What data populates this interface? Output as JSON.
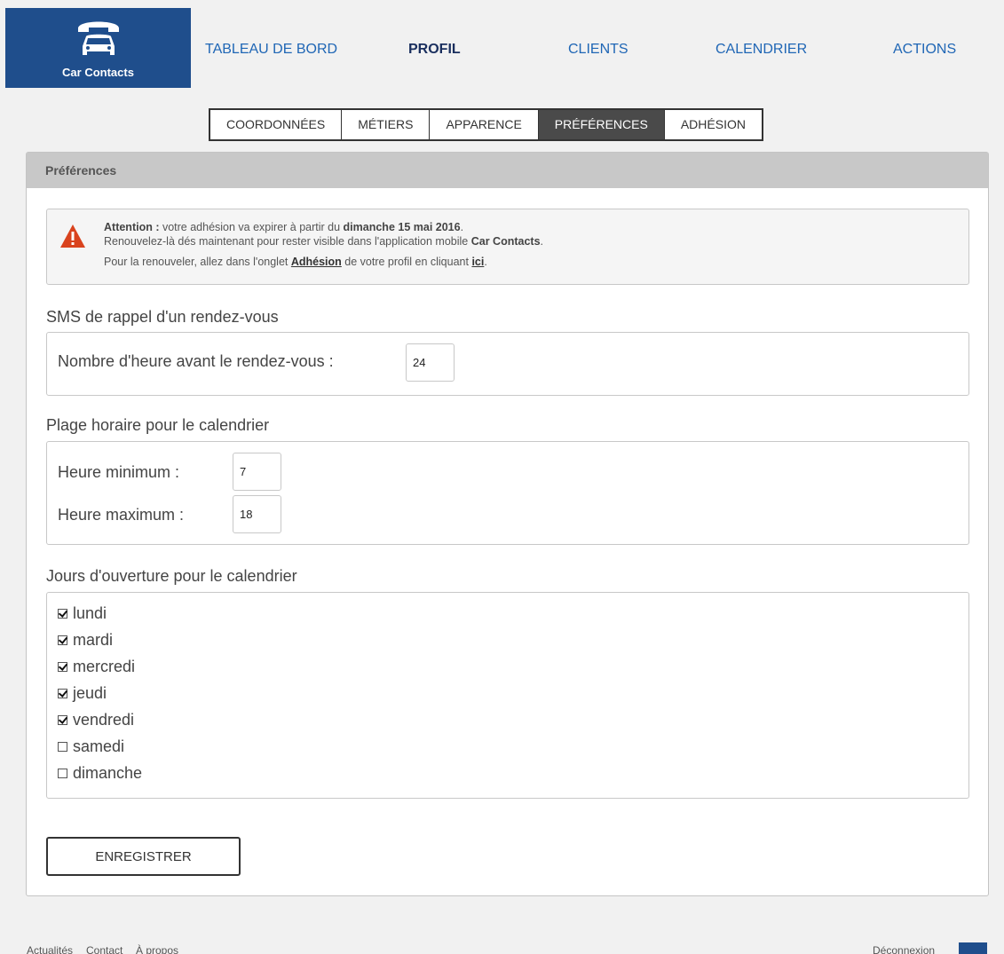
{
  "brand": {
    "name": "Car Contacts",
    "logo_icon": "car-phone-icon",
    "color": "#1f4e8c"
  },
  "nav": [
    {
      "label": "TABLEAU DE BORD",
      "active": false
    },
    {
      "label": "PROFIL",
      "active": true
    },
    {
      "label": "CLIENTS",
      "active": false
    },
    {
      "label": "CALENDRIER",
      "active": false
    },
    {
      "label": "ACTIONS",
      "active": false
    }
  ],
  "tabs": [
    {
      "label": "COORDONNÉES",
      "active": false
    },
    {
      "label": "MÉTIERS",
      "active": false
    },
    {
      "label": "APPARENCE",
      "active": false
    },
    {
      "label": "PRÉFÉRENCES",
      "active": true
    },
    {
      "label": "ADHÉSION",
      "active": false
    }
  ],
  "panel": {
    "title": "Préférences"
  },
  "alert": {
    "icon": "warning-icon",
    "attention_label": "Attention :",
    "line1_text": " votre adhésion va expirer à partir du ",
    "expiry_date": "dimanche 15 mai 2016",
    "line1_end": ".",
    "line2_text": "Renouvelez-là dés maintenant pour rester visible dans l'application mobile ",
    "app_name": "Car Contacts",
    "line2_end": ".",
    "line3_text": "Pour la renouveler, allez dans l'onglet ",
    "adhesion_link": "Adhésion",
    "line3_mid": " de votre profil en cliquant ",
    "ici_link": "ici",
    "line3_end": "."
  },
  "sms": {
    "title": "SMS de rappel d'un rendez-vous",
    "label": "Nombre d'heure avant le rendez-vous :",
    "value": "24"
  },
  "hours": {
    "title": "Plage horaire pour le calendrier",
    "min_label": "Heure minimum :",
    "min_value": "7",
    "max_label": "Heure maximum :",
    "max_value": "18"
  },
  "days": {
    "title": "Jours d'ouverture pour le calendrier",
    "items": [
      {
        "label": "lundi",
        "checked": true
      },
      {
        "label": "mardi",
        "checked": true
      },
      {
        "label": "mercredi",
        "checked": true
      },
      {
        "label": "jeudi",
        "checked": true
      },
      {
        "label": "vendredi",
        "checked": true
      },
      {
        "label": "samedi",
        "checked": false
      },
      {
        "label": "dimanche",
        "checked": false
      }
    ]
  },
  "save_label": "ENREGISTRER",
  "footer": {
    "links": [
      "Actualités",
      "Contact",
      "À propos"
    ],
    "logout": "Déconnexion"
  }
}
